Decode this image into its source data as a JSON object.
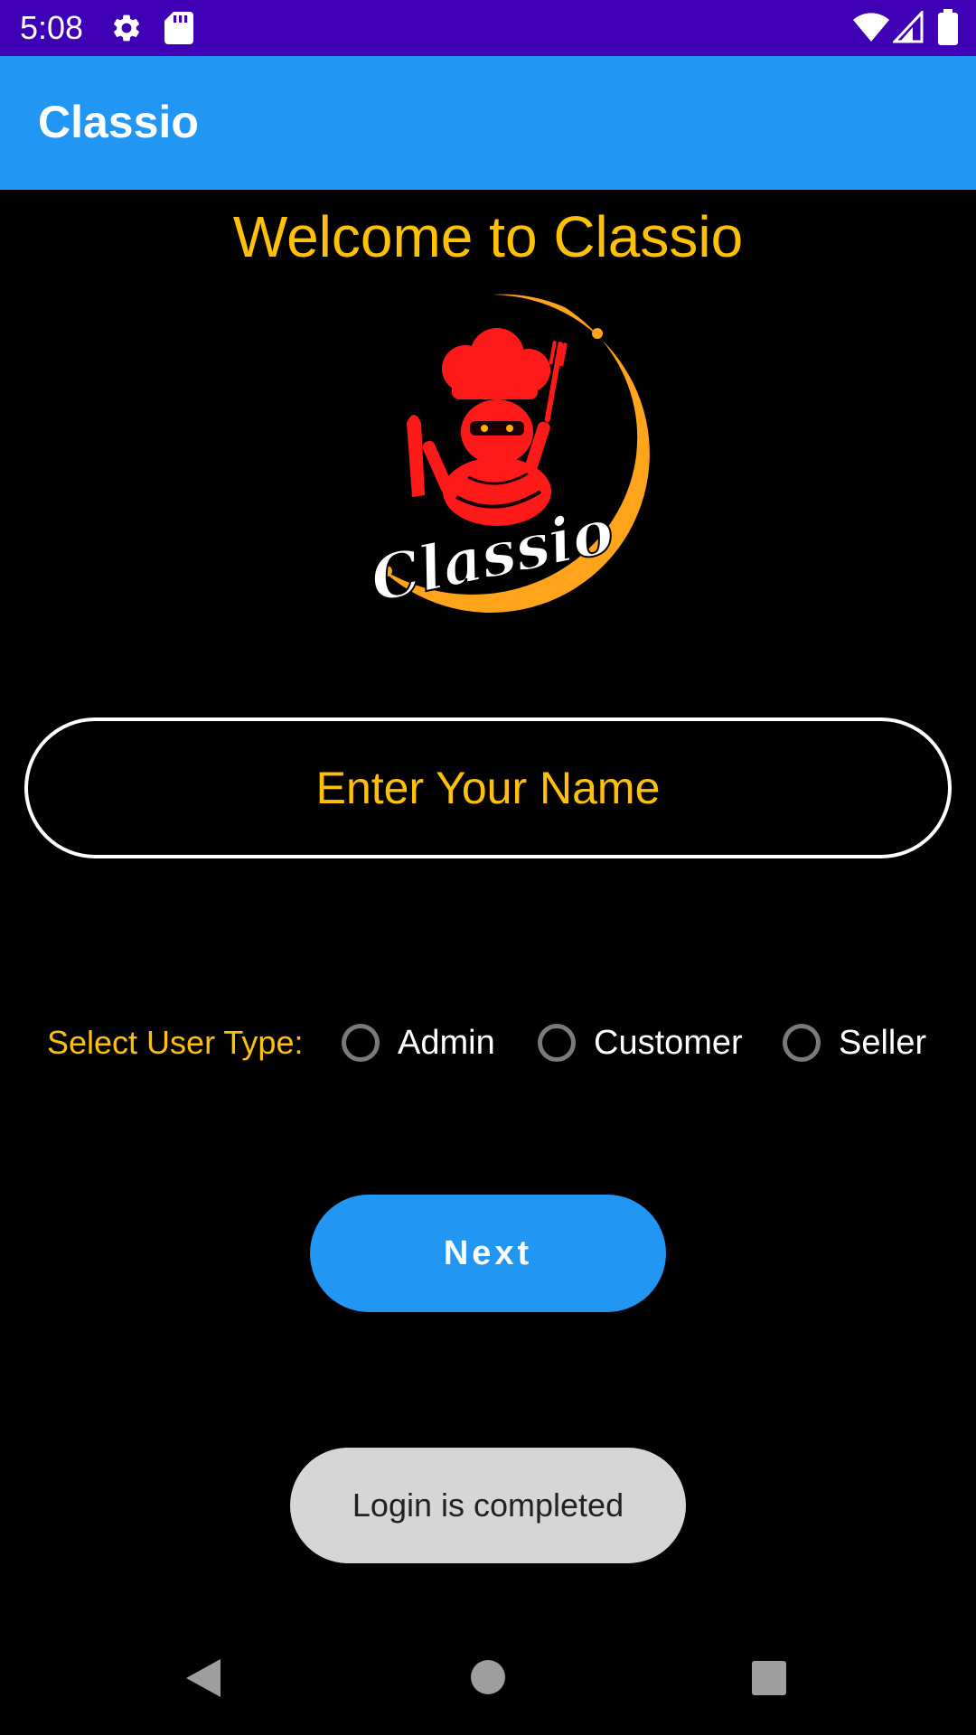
{
  "status_bar": {
    "time": "5:08",
    "icons": [
      "gear-icon",
      "sd-card-icon",
      "wifi-icon",
      "signal-icon",
      "battery-icon"
    ]
  },
  "app_bar": {
    "title": "Classio"
  },
  "welcome": {
    "text": "Welcome to Classio"
  },
  "logo": {
    "text": "Classio"
  },
  "name_input": {
    "placeholder": "Enter Your Name",
    "value": ""
  },
  "user_type": {
    "label": "Select User Type:",
    "options": [
      {
        "label": "Admin",
        "selected": false
      },
      {
        "label": "Customer",
        "selected": false
      },
      {
        "label": "Seller",
        "selected": false
      }
    ]
  },
  "next_button": {
    "label": "Next"
  },
  "toast": {
    "text": "Login is completed"
  },
  "nav_bar": {
    "icons": [
      "back-icon",
      "home-icon",
      "recents-icon"
    ]
  },
  "colors": {
    "status_bar": "#3f00b5",
    "app_bar": "#2196f3",
    "accent": "#ffc107",
    "background": "#000000",
    "button": "#2196f3",
    "toast": "#d6d6d6"
  }
}
